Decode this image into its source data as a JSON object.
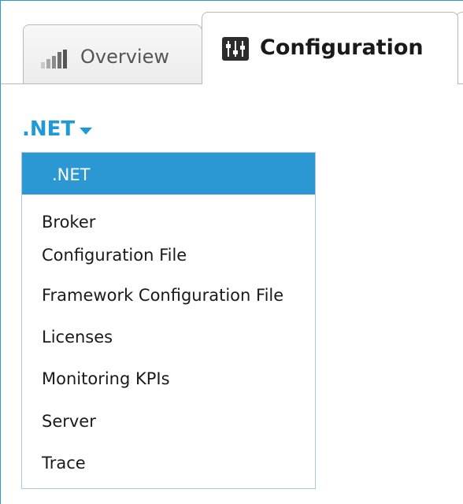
{
  "tabs": [
    {
      "label": "Overview",
      "icon": "bar-chart-icon",
      "active": false
    },
    {
      "label": "Configuration",
      "icon": "sliders-icon",
      "active": true
    }
  ],
  "dropdown": {
    "selected_label": ".NET",
    "items": [
      {
        "label": ".NET",
        "selected": true
      },
      {
        "label": "Broker"
      },
      {
        "label": "Configuration File"
      },
      {
        "label": "Framework Configuration File"
      },
      {
        "label": "Licenses"
      },
      {
        "label": "Monitoring KPIs"
      },
      {
        "label": "Server"
      },
      {
        "label": "Trace"
      }
    ]
  },
  "colors": {
    "accent": "#2b98d4",
    "link": "#1f9ad8",
    "tab_border": "#b9b9b9"
  }
}
